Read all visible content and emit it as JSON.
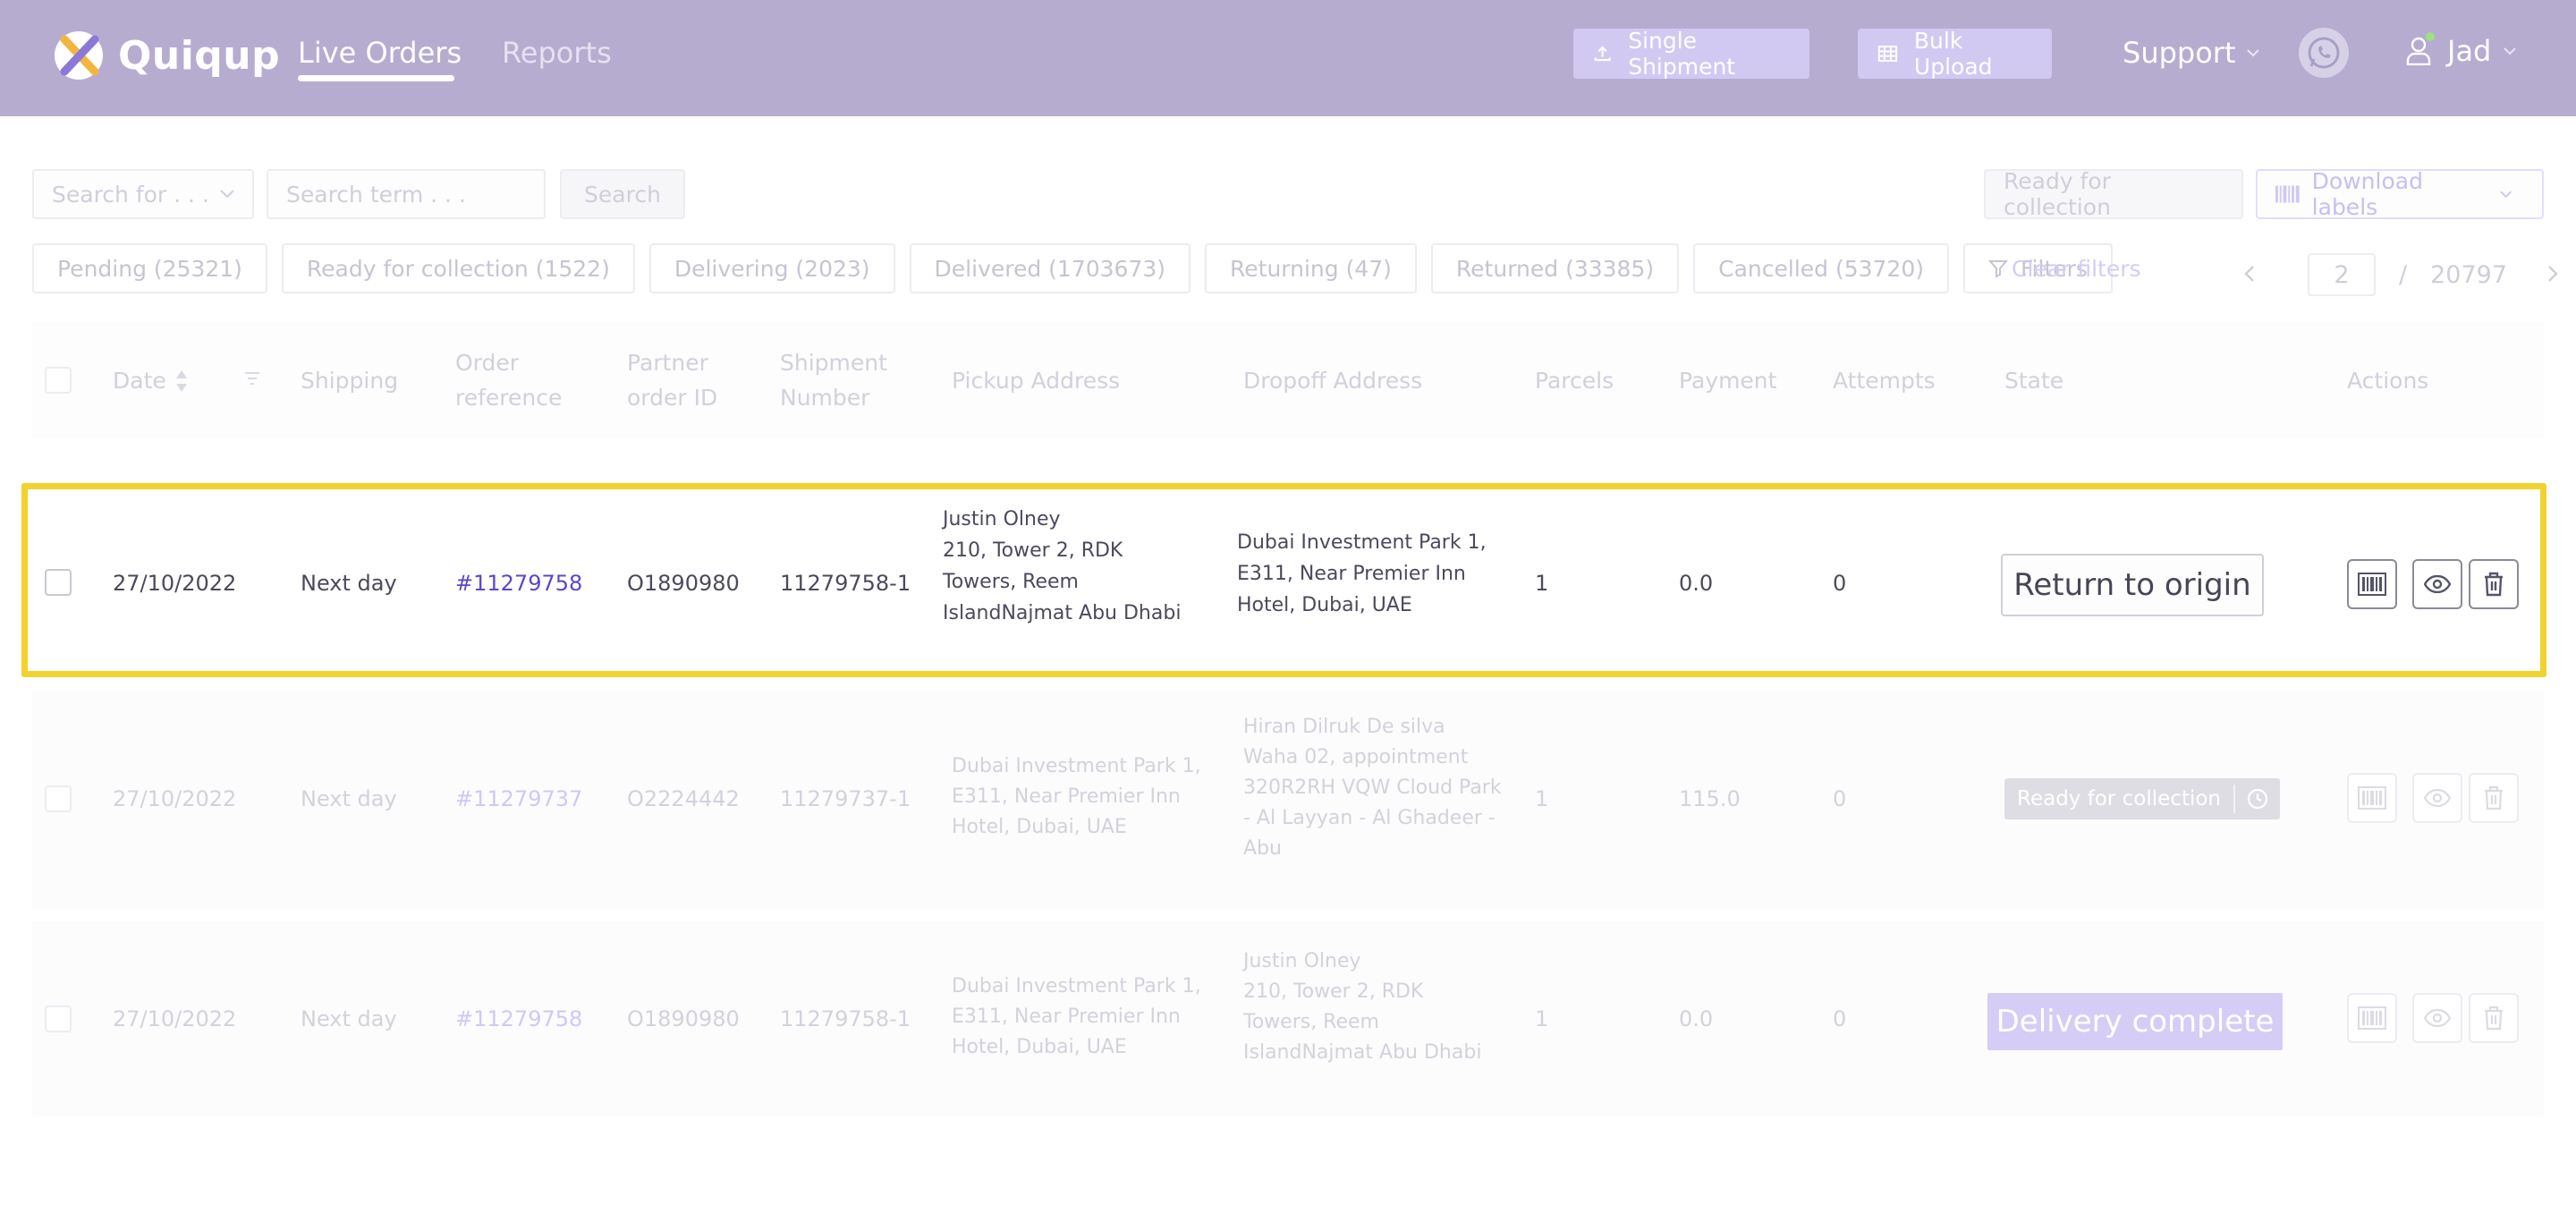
{
  "header": {
    "brand": "Quiqup",
    "nav": {
      "live_orders": "Live Orders",
      "reports": "Reports"
    },
    "single_shipment": "Single Shipment",
    "bulk_upload": "Bulk Upload",
    "support": "Support",
    "user_name": "Jad",
    "colors": {
      "bar": "#b6acd0",
      "online_dot": "#9fe07f"
    }
  },
  "toolbar": {
    "search_select_placeholder": "Search for . . .",
    "search_term_placeholder": "Search term . . .",
    "search_button": "Search",
    "ready_for_collection_button": "Ready for collection",
    "download_labels": "Download labels"
  },
  "filters": {
    "chips": [
      "Pending (25321)",
      "Ready for collection (1522)",
      "Delivering (2023)",
      "Delivered (1703673)",
      "Returning (47)",
      "Returned (33385)",
      "Cancelled (53720)"
    ],
    "filters_button": "Filters",
    "clear": "Clear filters"
  },
  "pagination": {
    "current": "2",
    "separator": "/",
    "total": "20797"
  },
  "table": {
    "columns": {
      "date": "Date",
      "shipping": "Shipping",
      "order_ref_1": "Order",
      "order_ref_2": "reference",
      "partner_1": "Partner",
      "partner_2": "order ID",
      "shipment_1": "Shipment",
      "shipment_2": "Number",
      "pickup": "Pickup Address",
      "dropoff": "Dropoff Address",
      "parcels": "Parcels",
      "payment": "Payment",
      "attempts": "Attempts",
      "state": "State",
      "actions": "Actions"
    },
    "rows": [
      {
        "date": "27/10/2022",
        "shipping": "Next day",
        "order_ref": "#11279758",
        "partner_id": "O1890980",
        "shipment": "11279758-1",
        "pickup": [
          "Justin Olney",
          "210, Tower 2, RDK",
          "Towers, Reem",
          "IslandNajmat Abu Dhabi"
        ],
        "dropoff": [
          "Dubai Investment Park 1,",
          "E311, Near Premier Inn",
          "Hotel, Dubai, UAE"
        ],
        "parcels": "1",
        "payment": "0.0",
        "attempts": "0",
        "state_button": "Return to origin"
      },
      {
        "date": "27/10/2022",
        "shipping": "Next day",
        "order_ref": "#11279737",
        "partner_id": "O2224442",
        "shipment": "11279737-1",
        "pickup": [
          "Dubai Investment Park 1,",
          "E311, Near Premier Inn",
          "Hotel, Dubai, UAE"
        ],
        "dropoff": [
          "Hiran Dilruk De silva",
          "Waha 02, appointment",
          "320R2RH VQW Cloud Park",
          "- Al Layyan - Al Ghadeer -",
          "Abu"
        ],
        "parcels": "1",
        "payment": "115.0",
        "attempts": "0",
        "state": "Ready for collection"
      },
      {
        "date": "27/10/2022",
        "shipping": "Next day",
        "order_ref": "#11279758",
        "partner_id": "O1890980",
        "shipment": "11279758-1",
        "pickup": [
          "Dubai Investment Park 1,",
          "E311, Near Premier Inn",
          "Hotel, Dubai, UAE"
        ],
        "dropoff": [
          "Justin Olney",
          "210, Tower 2, RDK",
          "Towers, Reem",
          "IslandNajmat Abu Dhabi"
        ],
        "parcels": "1",
        "payment": "0.0",
        "attempts": "0",
        "state": "Delivery complete"
      }
    ]
  },
  "highlight_color": "#f2d22e"
}
